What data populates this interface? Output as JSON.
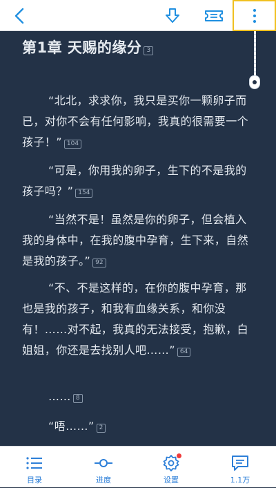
{
  "icons": {
    "back": "back-arrow-icon",
    "download": "download-icon",
    "ticket": "ticket-icon",
    "more": "more-vertical-icon",
    "catalog": "list-icon",
    "progress": "progress-slider-icon",
    "settings": "gear-icon",
    "comments": "comment-icon"
  },
  "colors": {
    "accent": "#1f8fe0",
    "reader_background": "#233247",
    "text": "#e3e8ee",
    "notification_dot": "#ef3b3b"
  },
  "chapter": {
    "title": "第1章 天赐的缘分",
    "comment_count": "3"
  },
  "paragraphs": [
    {
      "text": "“北北，求求你，我只是买你一颗卵子而已，对你不会有任何影响，我真的很需要一个孩子！”",
      "comments": "104"
    },
    {
      "text": "“可是，你用我的卵子，生下的不是我的孩子吗？”",
      "comments": "154"
    },
    {
      "text": "“当然不是！虽然是你的卵子，但会植入我的身体中，在我的腹中孕育，生下来，自然是我的孩子。”",
      "comments": "92"
    },
    {
      "text": "“不、不是这样的，在你的腹中孕育，那也是我的孩子，和我有血缘关系，和你没有！……对不起，我真的无法接受，抱歉，白姐姐，你还是去找别人吧……”",
      "comments": "64"
    },
    {
      "text": "……",
      "comments": "8"
    },
    {
      "text": "“唔……”",
      "comments": "2"
    }
  ],
  "bottom_nav": {
    "catalog": "目录",
    "progress": "进度",
    "settings": "设置",
    "comments": "1.1万"
  }
}
